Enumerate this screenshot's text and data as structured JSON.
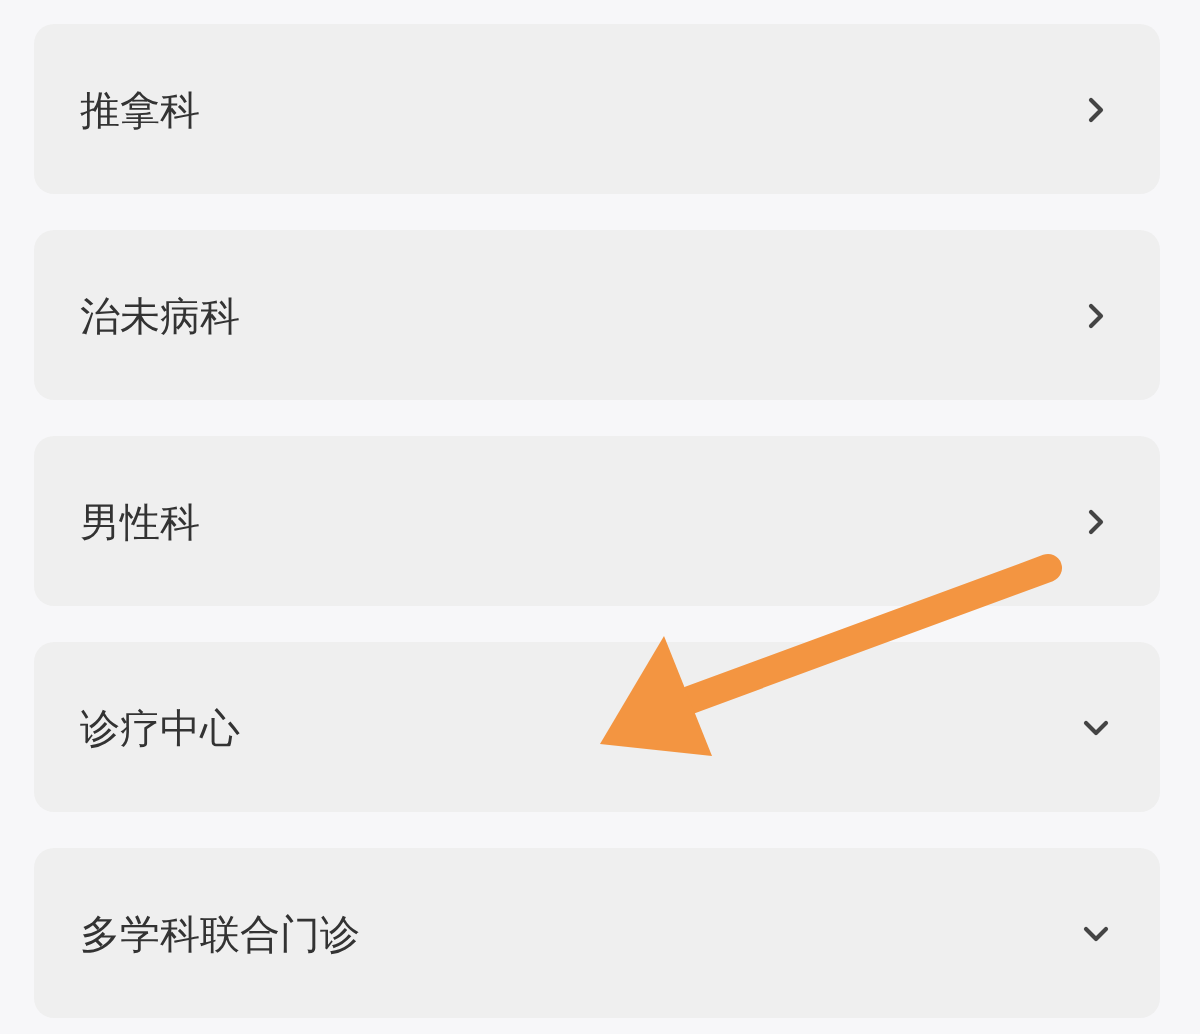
{
  "departments": [
    {
      "name": "推拿科",
      "kind": "link"
    },
    {
      "name": "治未病科",
      "kind": "link"
    },
    {
      "name": "男性科",
      "kind": "link"
    },
    {
      "name": "诊疗中心",
      "kind": "group"
    },
    {
      "name": "多学科联合门诊",
      "kind": "group"
    }
  ]
}
